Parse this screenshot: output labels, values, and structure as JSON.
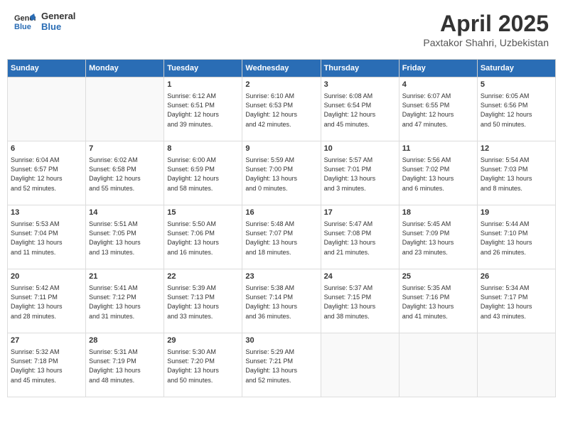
{
  "header": {
    "logo_line1": "General",
    "logo_line2": "Blue",
    "month_year": "April 2025",
    "location": "Paxtakor Shahri, Uzbekistan"
  },
  "weekdays": [
    "Sunday",
    "Monday",
    "Tuesday",
    "Wednesday",
    "Thursday",
    "Friday",
    "Saturday"
  ],
  "weeks": [
    [
      {
        "day": "",
        "info": ""
      },
      {
        "day": "",
        "info": ""
      },
      {
        "day": "1",
        "info": "Sunrise: 6:12 AM\nSunset: 6:51 PM\nDaylight: 12 hours\nand 39 minutes."
      },
      {
        "day": "2",
        "info": "Sunrise: 6:10 AM\nSunset: 6:53 PM\nDaylight: 12 hours\nand 42 minutes."
      },
      {
        "day": "3",
        "info": "Sunrise: 6:08 AM\nSunset: 6:54 PM\nDaylight: 12 hours\nand 45 minutes."
      },
      {
        "day": "4",
        "info": "Sunrise: 6:07 AM\nSunset: 6:55 PM\nDaylight: 12 hours\nand 47 minutes."
      },
      {
        "day": "5",
        "info": "Sunrise: 6:05 AM\nSunset: 6:56 PM\nDaylight: 12 hours\nand 50 minutes."
      }
    ],
    [
      {
        "day": "6",
        "info": "Sunrise: 6:04 AM\nSunset: 6:57 PM\nDaylight: 12 hours\nand 52 minutes."
      },
      {
        "day": "7",
        "info": "Sunrise: 6:02 AM\nSunset: 6:58 PM\nDaylight: 12 hours\nand 55 minutes."
      },
      {
        "day": "8",
        "info": "Sunrise: 6:00 AM\nSunset: 6:59 PM\nDaylight: 12 hours\nand 58 minutes."
      },
      {
        "day": "9",
        "info": "Sunrise: 5:59 AM\nSunset: 7:00 PM\nDaylight: 13 hours\nand 0 minutes."
      },
      {
        "day": "10",
        "info": "Sunrise: 5:57 AM\nSunset: 7:01 PM\nDaylight: 13 hours\nand 3 minutes."
      },
      {
        "day": "11",
        "info": "Sunrise: 5:56 AM\nSunset: 7:02 PM\nDaylight: 13 hours\nand 6 minutes."
      },
      {
        "day": "12",
        "info": "Sunrise: 5:54 AM\nSunset: 7:03 PM\nDaylight: 13 hours\nand 8 minutes."
      }
    ],
    [
      {
        "day": "13",
        "info": "Sunrise: 5:53 AM\nSunset: 7:04 PM\nDaylight: 13 hours\nand 11 minutes."
      },
      {
        "day": "14",
        "info": "Sunrise: 5:51 AM\nSunset: 7:05 PM\nDaylight: 13 hours\nand 13 minutes."
      },
      {
        "day": "15",
        "info": "Sunrise: 5:50 AM\nSunset: 7:06 PM\nDaylight: 13 hours\nand 16 minutes."
      },
      {
        "day": "16",
        "info": "Sunrise: 5:48 AM\nSunset: 7:07 PM\nDaylight: 13 hours\nand 18 minutes."
      },
      {
        "day": "17",
        "info": "Sunrise: 5:47 AM\nSunset: 7:08 PM\nDaylight: 13 hours\nand 21 minutes."
      },
      {
        "day": "18",
        "info": "Sunrise: 5:45 AM\nSunset: 7:09 PM\nDaylight: 13 hours\nand 23 minutes."
      },
      {
        "day": "19",
        "info": "Sunrise: 5:44 AM\nSunset: 7:10 PM\nDaylight: 13 hours\nand 26 minutes."
      }
    ],
    [
      {
        "day": "20",
        "info": "Sunrise: 5:42 AM\nSunset: 7:11 PM\nDaylight: 13 hours\nand 28 minutes."
      },
      {
        "day": "21",
        "info": "Sunrise: 5:41 AM\nSunset: 7:12 PM\nDaylight: 13 hours\nand 31 minutes."
      },
      {
        "day": "22",
        "info": "Sunrise: 5:39 AM\nSunset: 7:13 PM\nDaylight: 13 hours\nand 33 minutes."
      },
      {
        "day": "23",
        "info": "Sunrise: 5:38 AM\nSunset: 7:14 PM\nDaylight: 13 hours\nand 36 minutes."
      },
      {
        "day": "24",
        "info": "Sunrise: 5:37 AM\nSunset: 7:15 PM\nDaylight: 13 hours\nand 38 minutes."
      },
      {
        "day": "25",
        "info": "Sunrise: 5:35 AM\nSunset: 7:16 PM\nDaylight: 13 hours\nand 41 minutes."
      },
      {
        "day": "26",
        "info": "Sunrise: 5:34 AM\nSunset: 7:17 PM\nDaylight: 13 hours\nand 43 minutes."
      }
    ],
    [
      {
        "day": "27",
        "info": "Sunrise: 5:32 AM\nSunset: 7:18 PM\nDaylight: 13 hours\nand 45 minutes."
      },
      {
        "day": "28",
        "info": "Sunrise: 5:31 AM\nSunset: 7:19 PM\nDaylight: 13 hours\nand 48 minutes."
      },
      {
        "day": "29",
        "info": "Sunrise: 5:30 AM\nSunset: 7:20 PM\nDaylight: 13 hours\nand 50 minutes."
      },
      {
        "day": "30",
        "info": "Sunrise: 5:29 AM\nSunset: 7:21 PM\nDaylight: 13 hours\nand 52 minutes."
      },
      {
        "day": "",
        "info": ""
      },
      {
        "day": "",
        "info": ""
      },
      {
        "day": "",
        "info": ""
      }
    ]
  ]
}
